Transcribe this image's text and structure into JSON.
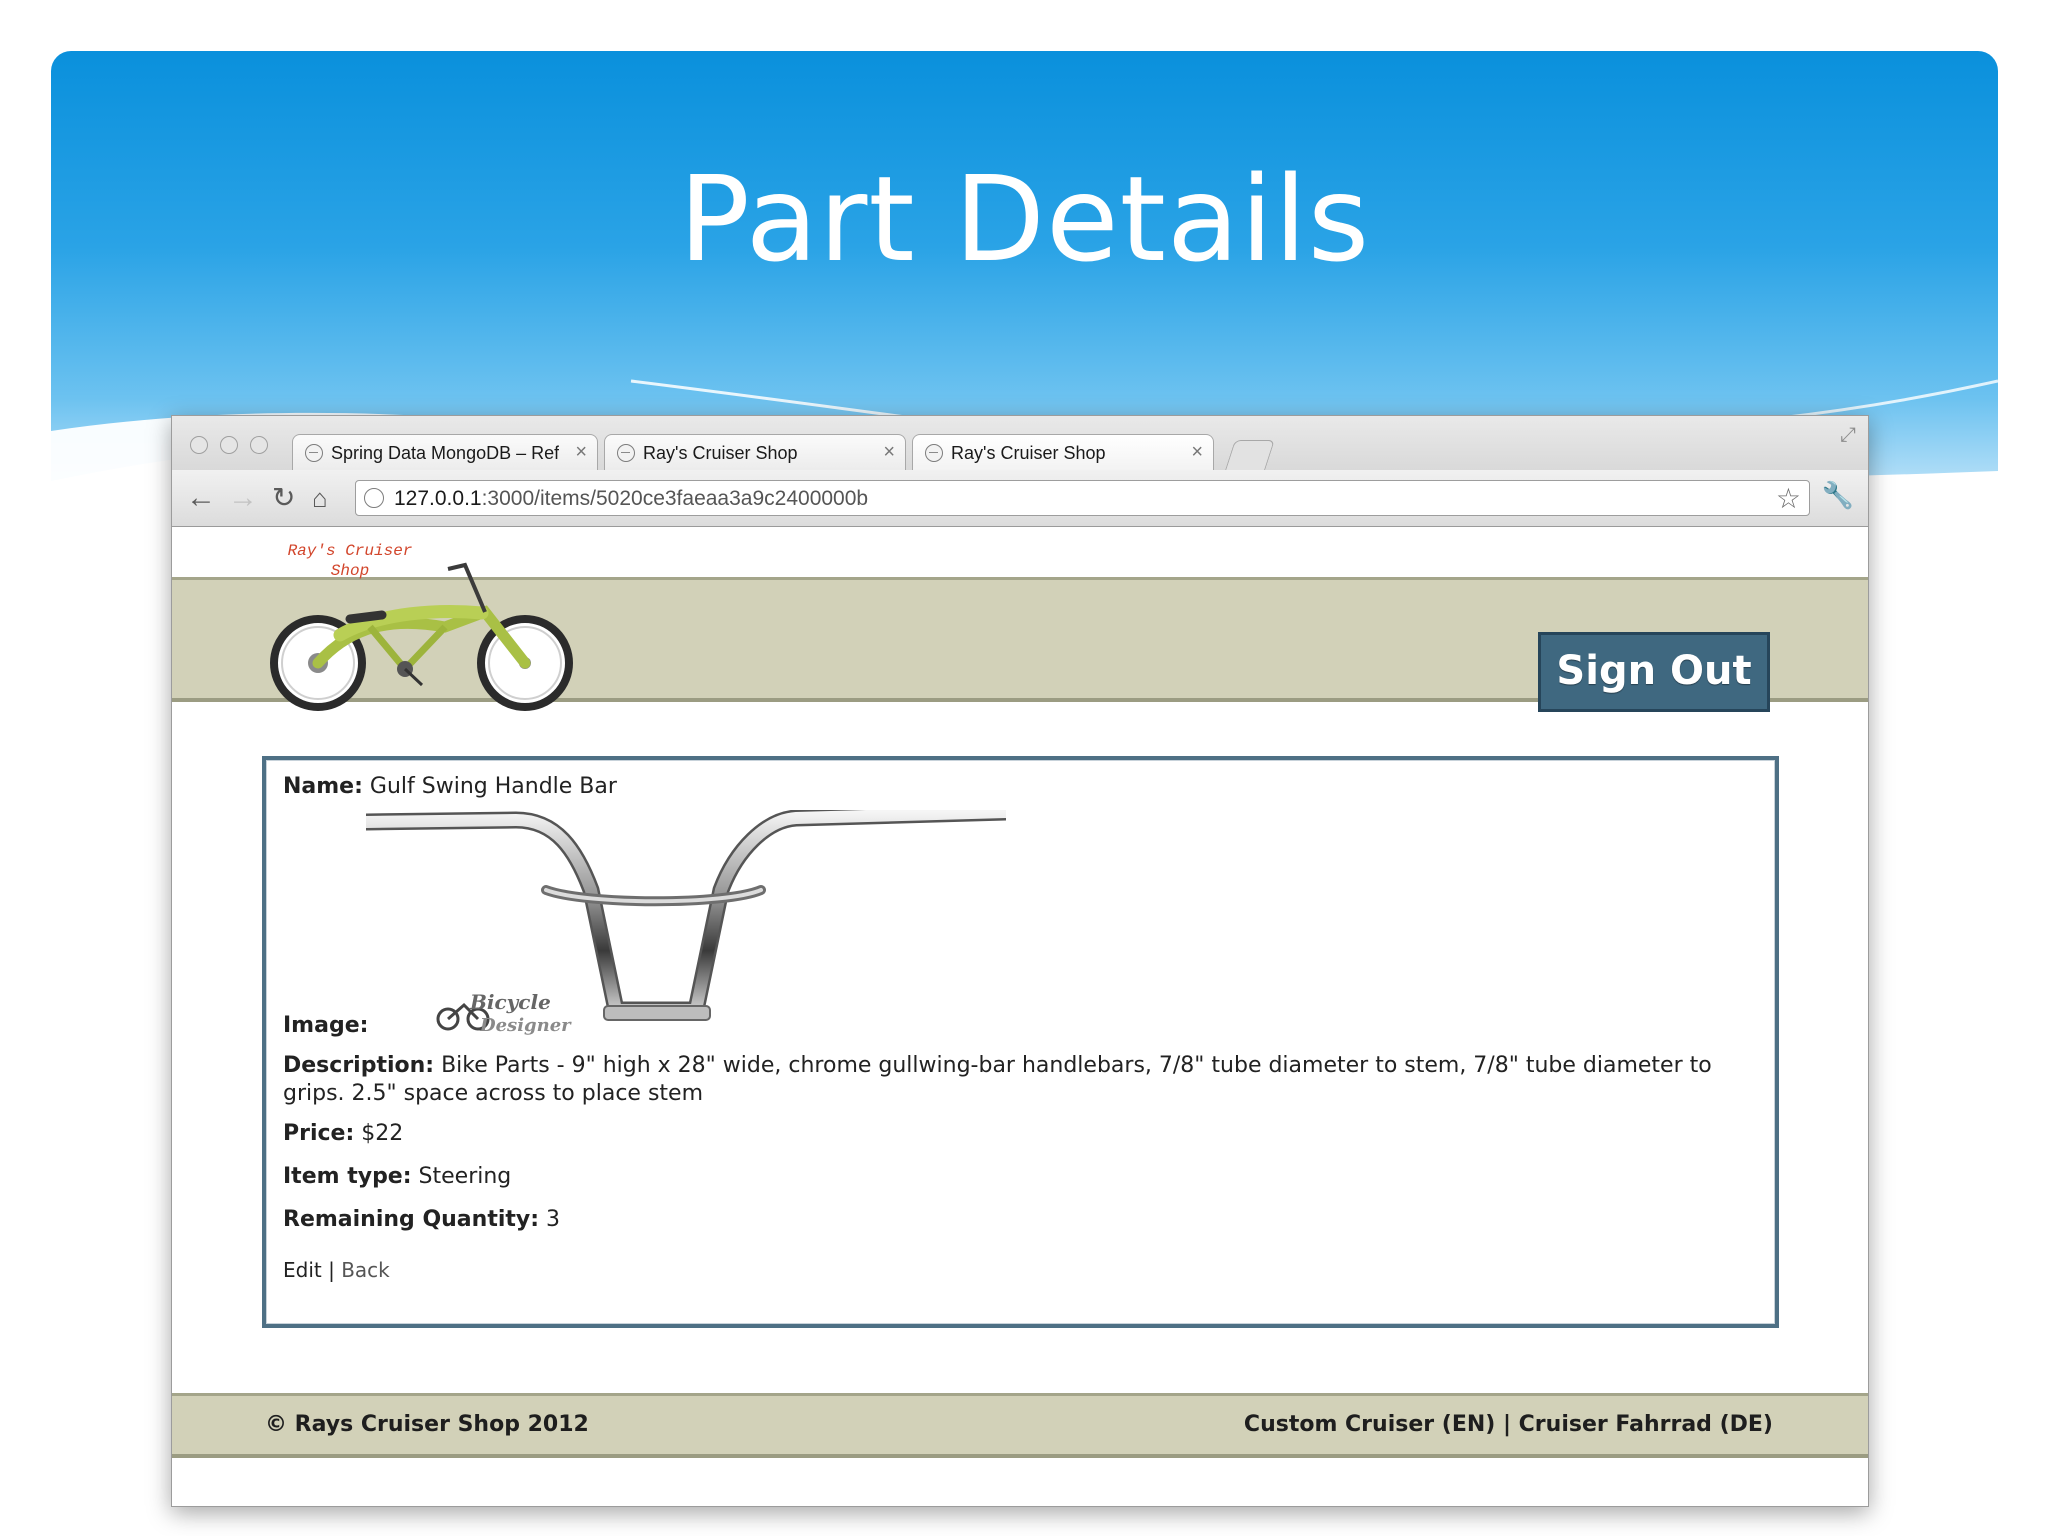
{
  "slide": {
    "title": "Part Details"
  },
  "browser": {
    "tabs": [
      {
        "label": "Spring Data MongoDB – Refe",
        "close": "×"
      },
      {
        "label": "Ray's Cruiser Shop",
        "close": "×"
      },
      {
        "label": "Ray's Cruiser Shop",
        "close": "×"
      }
    ],
    "address": {
      "host": "127.0.0.1",
      "path": ":3000/items/5020ce3faeaa3a9c2400000b"
    },
    "icons": [
      "back-icon",
      "forward-icon",
      "reload-icon",
      "home-icon",
      "globe-icon",
      "bookmark-star-icon",
      "wrench-icon",
      "resize-icon"
    ]
  },
  "site": {
    "logo_text": "Ray's Cruiser Shop",
    "sign_out_label": "Sign Out",
    "footer_left": "© Rays Cruiser Shop 2012",
    "footer_right": "Custom Cruiser (EN) | Cruiser Fahrrad (DE)"
  },
  "item": {
    "name_label": "Name:",
    "name": "Gulf Swing Handle Bar",
    "image_label": "Image:",
    "image_watermark": "Bicycle Designer",
    "description_label": "Description:",
    "description": "Bike Parts - 9\" high x 28\" wide, chrome gullwing-bar handlebars, 7/8\" tube diameter to stem, 7/8\" tube diameter to grips. 2.5\" space across to place stem",
    "price_label": "Price:",
    "price": "$22",
    "type_label": "Item type:",
    "type": "Steering",
    "quantity_label": "Remaining Quantity:",
    "quantity": "3",
    "edit_link": "Edit",
    "separator": "|",
    "back_link": "Back"
  },
  "colors": {
    "slide_blue": "#0a90dc",
    "band": "#d2d1b8",
    "sign_out": "#3f6880",
    "details_border": "#4e7085"
  }
}
